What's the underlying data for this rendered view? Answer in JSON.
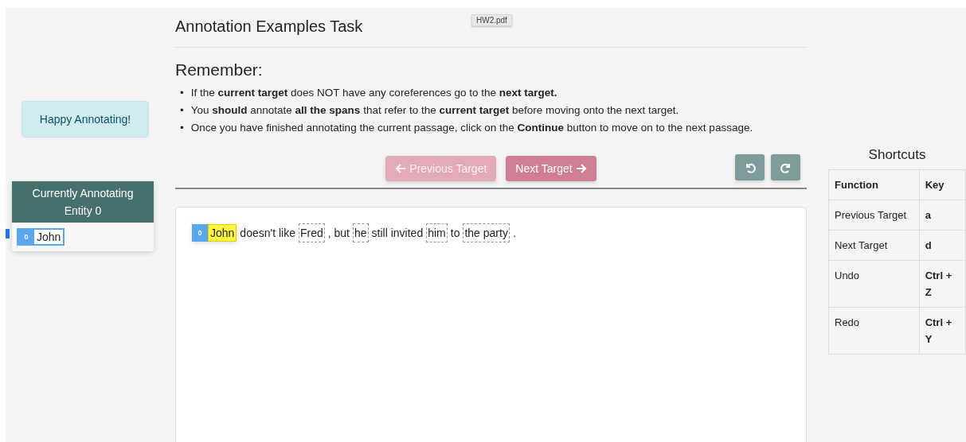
{
  "tooltip": "HW2.pdf",
  "sidebar": {
    "alert": "Happy Annotating!",
    "panel_title": "Currently Annotating Entity 0",
    "entities": [
      {
        "badge": "0",
        "label": "John",
        "selected": true
      }
    ]
  },
  "title": "Annotation Examples Task",
  "remember": {
    "heading": "Remember:",
    "items": [
      {
        "bullet": "•",
        "text": "If the **current target** does NOT have any coreferences go to the **next target.**"
      },
      {
        "bullet": "•",
        "text": "You **should** annotate **all the spans** that refer to the **current target** before moving onto the next target."
      },
      {
        "bullet": "•",
        "text": "Once you have finished annotating the current passage, click on the **Continue** button to move on to the next passage."
      }
    ]
  },
  "nav": [
    {
      "label": "Previous Target",
      "kind": "previous",
      "disabled": true
    },
    {
      "label": "Next Target",
      "kind": "next",
      "disabled": false
    }
  ],
  "history": [
    {
      "kind": "undo"
    },
    {
      "kind": "redo"
    }
  ],
  "passage": [
    {
      "kind": "entity",
      "badge": "0",
      "text": "John"
    },
    {
      "kind": "plain",
      "text": "doesn't like"
    },
    {
      "kind": "candidate",
      "text": "Fred"
    },
    {
      "kind": "plain",
      "text": ", but"
    },
    {
      "kind": "candidate",
      "text": "he"
    },
    {
      "kind": "plain",
      "text": "still invited"
    },
    {
      "kind": "candidate",
      "text": "him"
    },
    {
      "kind": "plain",
      "text": "to"
    },
    {
      "kind": "candidate",
      "text": "the party"
    },
    {
      "kind": "plain",
      "text": "."
    }
  ],
  "shortcuts": {
    "title": "Shortcuts",
    "columns": [
      "Function",
      "Key"
    ],
    "rows": [
      [
        "Previous Target",
        "a"
      ],
      [
        "Next Target",
        "d"
      ],
      [
        "Undo",
        "Ctrl + Z"
      ],
      [
        "Redo",
        "Ctrl + Y"
      ]
    ]
  }
}
